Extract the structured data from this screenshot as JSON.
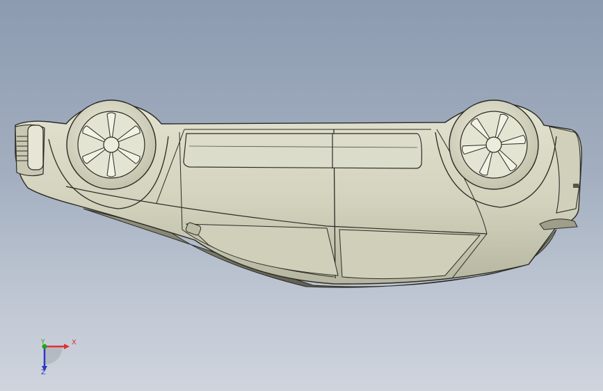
{
  "viewport": {
    "background_top": "#8c9bb0",
    "background_bottom": "#cfd4dd",
    "model_color": "#d6d6c2",
    "edge_color": "#2a2a24"
  },
  "model": {
    "name": "car-model-upside-down",
    "parts": [
      "body",
      "front-wheel",
      "rear-wheel",
      "windows",
      "front-grille",
      "door-handle"
    ]
  },
  "triad": {
    "x_label": "X",
    "y_label": "Y",
    "z_label": "Z",
    "x_color": "#e03030",
    "y_color": "#1fa31f",
    "z_color": "#2a39c8"
  }
}
